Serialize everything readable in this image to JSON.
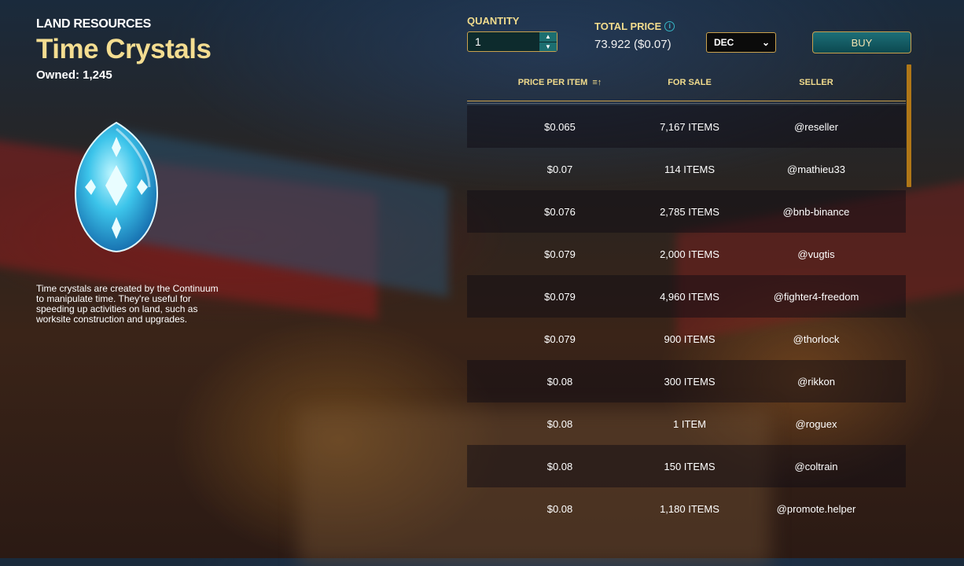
{
  "item": {
    "category": "LAND RESOURCES",
    "name": "Time Crystals",
    "owned": "Owned: 1,245",
    "description": "Time crystals are created by the Continuum to manipulate time. They're useful for speeding up activities on land, such as worksite construction and upgrades."
  },
  "purchase": {
    "quantity_label": "QUANTITY",
    "quantity_value": "1",
    "total_price_label": "TOTAL PRICE",
    "total_price_value": "73.922 ($0.07)",
    "currency_selected": "DEC",
    "buy_label": "BUY"
  },
  "table": {
    "headers": [
      "PRICE PER ITEM",
      "FOR SALE",
      "SELLER"
    ],
    "rows": [
      {
        "price": "$0.065",
        "for_sale": "7,167 ITEMS",
        "seller": "@reseller"
      },
      {
        "price": "$0.07",
        "for_sale": "114 ITEMS",
        "seller": "@mathieu33"
      },
      {
        "price": "$0.076",
        "for_sale": "2,785 ITEMS",
        "seller": "@bnb-binance"
      },
      {
        "price": "$0.079",
        "for_sale": "2,000 ITEMS",
        "seller": "@vugtis"
      },
      {
        "price": "$0.079",
        "for_sale": "4,960 ITEMS",
        "seller": "@fighter4-freedom"
      },
      {
        "price": "$0.079",
        "for_sale": "900 ITEMS",
        "seller": "@thorlock"
      },
      {
        "price": "$0.08",
        "for_sale": "300 ITEMS",
        "seller": "@rikkon"
      },
      {
        "price": "$0.08",
        "for_sale": "1 ITEM",
        "seller": "@roguex"
      },
      {
        "price": "$0.08",
        "for_sale": "150 ITEMS",
        "seller": "@coltrain"
      },
      {
        "price": "$0.08",
        "for_sale": "1,180 ITEMS",
        "seller": "@promote.helper"
      }
    ]
  },
  "icons": {
    "info": "info-icon",
    "sort": "sort-ascending-icon",
    "crystal": "time-crystal-icon"
  },
  "colors": {
    "accent_gold": "#f2dc8d",
    "border_gold": "#c9a14d",
    "teal": "#1c6e70"
  }
}
